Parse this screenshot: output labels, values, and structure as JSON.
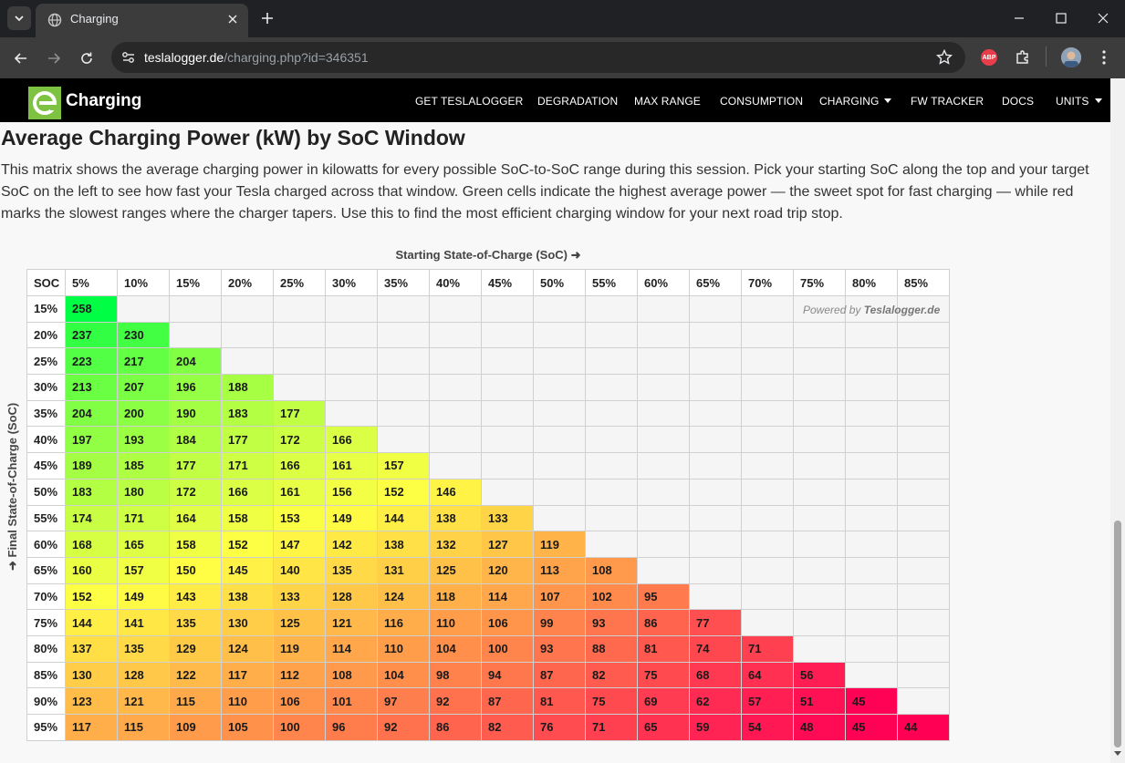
{
  "browser": {
    "tab_title": "Charging",
    "url_host": "teslalogger.de",
    "url_path": "/charging.php?id=346351"
  },
  "navbar": {
    "brand": "Charging",
    "items": [
      "GET TESLALOGGER",
      "DEGRADATION",
      "MAX RANGE",
      "CONSUMPTION",
      "CHARGING",
      "FW TRACKER",
      "DOCS",
      "UNITS"
    ]
  },
  "page": {
    "title": "Average Charging Power (kW) by SoC Window",
    "intro": "This matrix shows the average charging power in kilowatts for every possible SoC-to-SoC range during this session. Pick your starting SoC along the top and your target SoC on the left to see how fast your Tesla charged across that window. Green cells indicate the highest average power — the sweet spot for fast charging — while red marks the slowest ranges where the charger tapers. Use this to find the most efficient charging window for your next road trip stop.",
    "x_axis_title": "Starting State-of-Charge (SoC) ➜",
    "y_axis_title": "➜ Final State-of-Charge (SoC)",
    "powered_prefix": "Powered by",
    "powered_brand": "Teslalogger.de"
  },
  "chart_data": {
    "type": "heatmap",
    "title": "Average Charging Power (kW) by SoC Window",
    "xlabel": "Starting State-of-Charge (SoC)",
    "ylabel": "Final State-of-Charge (SoC)",
    "corner_label": "SOC",
    "x": [
      "5%",
      "10%",
      "15%",
      "20%",
      "25%",
      "30%",
      "35%",
      "40%",
      "45%",
      "50%",
      "55%",
      "60%",
      "65%",
      "70%",
      "75%",
      "80%",
      "85%"
    ],
    "y": [
      "15%",
      "20%",
      "25%",
      "30%",
      "35%",
      "40%",
      "45%",
      "50%",
      "55%",
      "60%",
      "65%",
      "70%",
      "75%",
      "80%",
      "85%",
      "90%",
      "95%"
    ],
    "values": [
      [
        258
      ],
      [
        237,
        230
      ],
      [
        223,
        217,
        204
      ],
      [
        213,
        207,
        196,
        188
      ],
      [
        204,
        200,
        190,
        183,
        177
      ],
      [
        197,
        193,
        184,
        177,
        172,
        166
      ],
      [
        189,
        185,
        177,
        171,
        166,
        161,
        157
      ],
      [
        183,
        180,
        172,
        166,
        161,
        156,
        152,
        146
      ],
      [
        174,
        171,
        164,
        158,
        153,
        149,
        144,
        138,
        133
      ],
      [
        168,
        165,
        158,
        152,
        147,
        142,
        138,
        132,
        127,
        119
      ],
      [
        160,
        157,
        150,
        145,
        140,
        135,
        131,
        125,
        120,
        113,
        108
      ],
      [
        152,
        149,
        143,
        138,
        133,
        128,
        124,
        118,
        114,
        107,
        102,
        95
      ],
      [
        144,
        141,
        135,
        130,
        125,
        121,
        116,
        110,
        106,
        99,
        93,
        86,
        77
      ],
      [
        137,
        135,
        129,
        124,
        119,
        114,
        110,
        104,
        100,
        93,
        88,
        81,
        74,
        71
      ],
      [
        130,
        128,
        122,
        117,
        112,
        108,
        104,
        98,
        94,
        87,
        82,
        75,
        68,
        64,
        56
      ],
      [
        123,
        121,
        115,
        110,
        106,
        101,
        97,
        92,
        87,
        81,
        75,
        69,
        62,
        57,
        51,
        45
      ],
      [
        117,
        115,
        109,
        105,
        100,
        96,
        92,
        86,
        82,
        76,
        71,
        65,
        59,
        54,
        48,
        45,
        44
      ]
    ],
    "color_scale": {
      "high": "#00ff44",
      "mid": "#ffff44",
      "low": "#ff0055"
    }
  }
}
